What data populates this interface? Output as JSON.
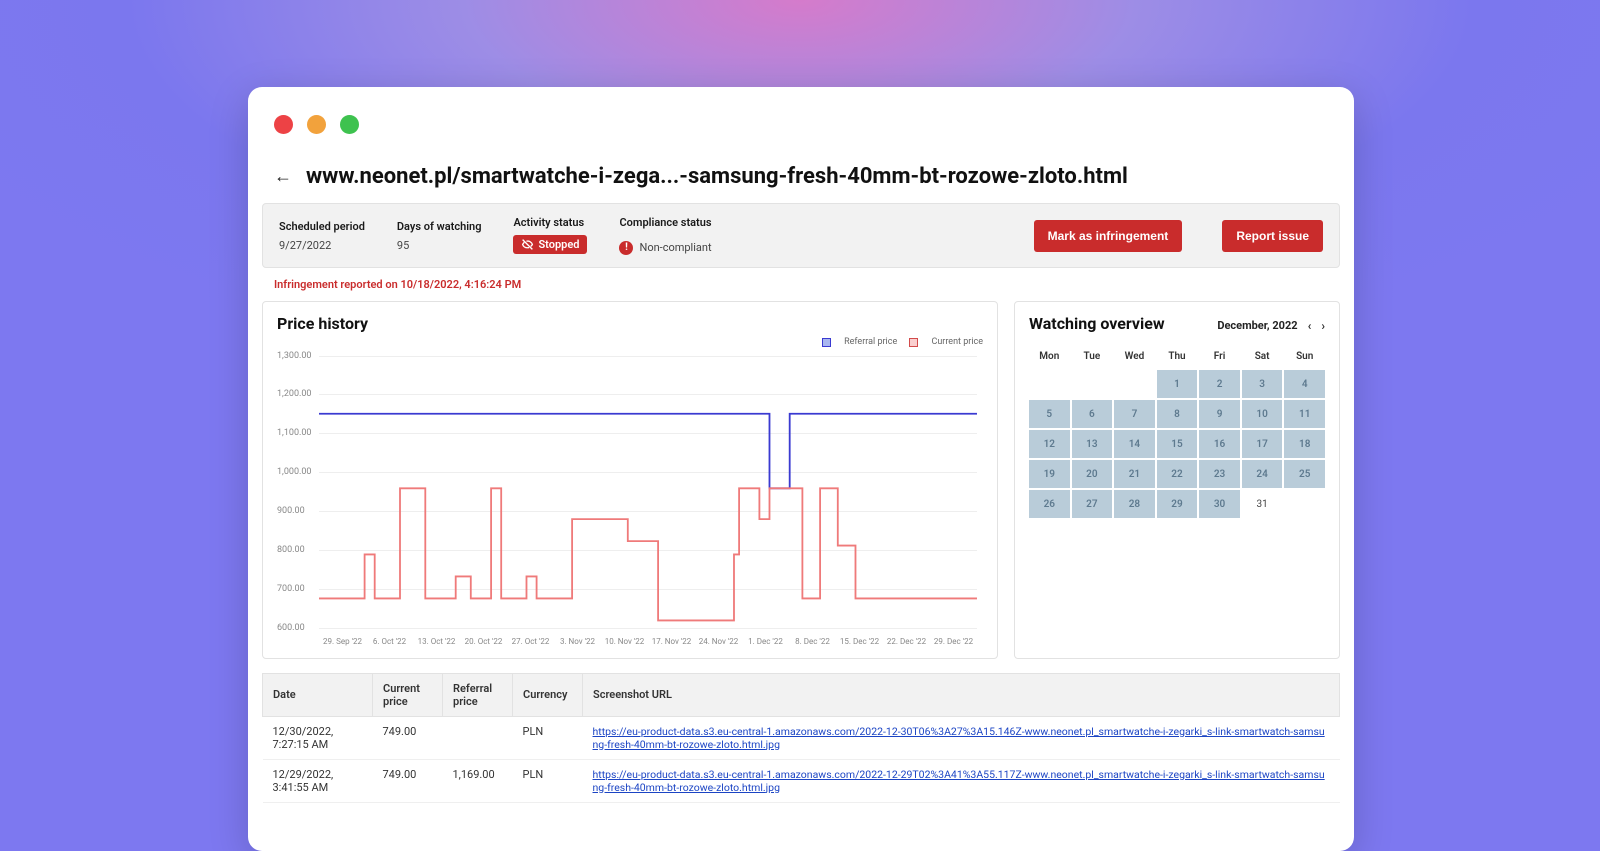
{
  "page": {
    "title": "www.neonet.pl/smartwatche-i-zega...-samsung-fresh-40mm-bt-rozowe-zloto.html"
  },
  "infobar": {
    "scheduled_label": "Scheduled period",
    "scheduled_value": "9/27/2022",
    "days_label": "Days of watching",
    "days_value": "95",
    "activity_label": "Activity status",
    "activity_value": "Stopped",
    "compliance_label": "Compliance status",
    "compliance_value": "Non-compliant",
    "mark_btn": "Mark as infringement",
    "report_btn": "Report issue"
  },
  "alert": "Infringement reported on 10/18/2022, 4:16:24 PM",
  "chart": {
    "title": "Price history",
    "legend_ref": "Referral price",
    "legend_cur": "Current price"
  },
  "chart_data": {
    "type": "line",
    "ylabel": "",
    "xlabel": "",
    "ylim": [
      600,
      1300
    ],
    "yticks": [
      "1,300.00",
      "1,200.00",
      "1,100.00",
      "1,000.00",
      "900.00",
      "800.00",
      "700.00",
      "600.00"
    ],
    "xticks": [
      "29. Sep '22",
      "6. Oct '22",
      "13. Oct '22",
      "20. Oct '22",
      "27. Oct '22",
      "3. Nov '22",
      "10. Nov '22",
      "17. Nov '22",
      "24. Nov '22",
      "1. Dec '22",
      "8. Dec '22",
      "15. Dec '22",
      "22. Dec '22",
      "29. Dec '22"
    ],
    "series": [
      {
        "name": "Referral price",
        "color": "#3a3ad1",
        "values": [
          [
            0,
            1169
          ],
          [
            8.9,
            1169
          ],
          [
            8.9,
            1000
          ],
          [
            9.3,
            1000
          ],
          [
            9.3,
            1169
          ],
          [
            13,
            1169
          ]
        ]
      },
      {
        "name": "Current price",
        "color": "#ef7a7a",
        "values": [
          [
            0,
            750
          ],
          [
            0.9,
            750
          ],
          [
            0.9,
            850
          ],
          [
            1.1,
            850
          ],
          [
            1.1,
            750
          ],
          [
            1.6,
            750
          ],
          [
            1.6,
            1000
          ],
          [
            2.1,
            1000
          ],
          [
            2.1,
            750
          ],
          [
            2.7,
            750
          ],
          [
            2.7,
            800
          ],
          [
            3.0,
            800
          ],
          [
            3.0,
            750
          ],
          [
            3.4,
            750
          ],
          [
            3.4,
            1000
          ],
          [
            3.6,
            1000
          ],
          [
            3.6,
            750
          ],
          [
            4.1,
            750
          ],
          [
            4.1,
            800
          ],
          [
            4.3,
            800
          ],
          [
            4.3,
            750
          ],
          [
            5.0,
            750
          ],
          [
            5.0,
            930
          ],
          [
            6.1,
            930
          ],
          [
            6.1,
            880
          ],
          [
            6.7,
            880
          ],
          [
            6.7,
            700
          ],
          [
            8.2,
            700
          ],
          [
            8.2,
            850
          ],
          [
            8.3,
            850
          ],
          [
            8.3,
            1000
          ],
          [
            8.7,
            1000
          ],
          [
            8.7,
            930
          ],
          [
            8.9,
            930
          ],
          [
            8.9,
            1000
          ],
          [
            9.55,
            1000
          ],
          [
            9.55,
            750
          ],
          [
            9.9,
            750
          ],
          [
            9.9,
            1000
          ],
          [
            10.25,
            1000
          ],
          [
            10.25,
            870
          ],
          [
            10.6,
            870
          ],
          [
            10.6,
            750
          ],
          [
            13,
            750
          ]
        ]
      }
    ]
  },
  "calendar": {
    "title": "Watching overview",
    "month": "December, 2022",
    "dow": [
      "Mon",
      "Tue",
      "Wed",
      "Thu",
      "Fri",
      "Sat",
      "Sun"
    ],
    "offset": 3,
    "days": [
      {
        "n": 1,
        "w": true
      },
      {
        "n": 2,
        "w": true
      },
      {
        "n": 3,
        "w": true
      },
      {
        "n": 4,
        "w": true
      },
      {
        "n": 5,
        "w": true
      },
      {
        "n": 6,
        "w": true
      },
      {
        "n": 7,
        "w": true
      },
      {
        "n": 8,
        "w": true
      },
      {
        "n": 9,
        "w": true
      },
      {
        "n": 10,
        "w": true
      },
      {
        "n": 11,
        "w": true
      },
      {
        "n": 12,
        "w": true
      },
      {
        "n": 13,
        "w": true
      },
      {
        "n": 14,
        "w": true
      },
      {
        "n": 15,
        "w": true
      },
      {
        "n": 16,
        "w": true
      },
      {
        "n": 17,
        "w": true
      },
      {
        "n": 18,
        "w": true
      },
      {
        "n": 19,
        "w": true
      },
      {
        "n": 20,
        "w": true
      },
      {
        "n": 21,
        "w": true
      },
      {
        "n": 22,
        "w": true
      },
      {
        "n": 23,
        "w": true
      },
      {
        "n": 24,
        "w": true
      },
      {
        "n": 25,
        "w": true
      },
      {
        "n": 26,
        "w": true
      },
      {
        "n": 27,
        "w": true
      },
      {
        "n": 28,
        "w": true
      },
      {
        "n": 29,
        "w": true
      },
      {
        "n": 30,
        "w": true
      },
      {
        "n": 31,
        "w": false
      }
    ]
  },
  "table": {
    "headers": {
      "date": "Date",
      "current": "Current price",
      "referral": "Referral price",
      "currency": "Currency",
      "url": "Screenshot URL"
    },
    "rows": [
      {
        "date": "12/30/2022, 7:27:15 AM",
        "current": "749.00",
        "referral": "",
        "currency": "PLN",
        "url": "https://eu-product-data.s3.eu-central-1.amazonaws.com/2022-12-30T06%3A27%3A15.146Z-www.neonet.pl_smartwatche-i-zegarki_s-link-smartwatch-samsung-fresh-40mm-bt-rozowe-zloto.html.jpg"
      },
      {
        "date": "12/29/2022, 3:41:55 AM",
        "current": "749.00",
        "referral": "1,169.00",
        "currency": "PLN",
        "url": "https://eu-product-data.s3.eu-central-1.amazonaws.com/2022-12-29T02%3A41%3A55.117Z-www.neonet.pl_smartwatche-i-zegarki_s-link-smartwatch-samsung-fresh-40mm-bt-rozowe-zloto.html.jpg"
      }
    ]
  }
}
